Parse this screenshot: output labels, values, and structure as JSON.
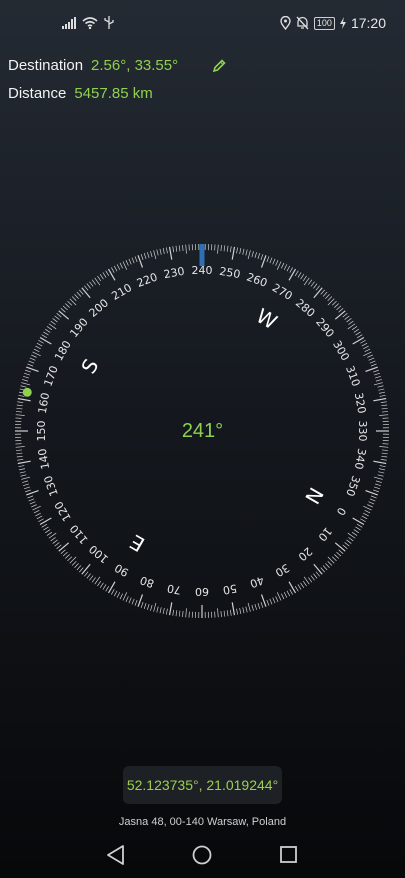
{
  "status_bar": {
    "time": "17:20",
    "battery": "100"
  },
  "destination": {
    "label": "Destination",
    "value": "2.56°, 33.55°"
  },
  "distance": {
    "label": "Distance",
    "value": "5457.85 km"
  },
  "compass": {
    "heading": "241°",
    "ring_labels": [
      "0",
      "10",
      "20",
      "30",
      "40",
      "50",
      "60",
      "70",
      "80",
      "90",
      "100",
      "110",
      "120",
      "130",
      "140",
      "150",
      "160",
      "170",
      "180",
      "190",
      "200",
      "210",
      "220",
      "230",
      "240",
      "250",
      "260",
      "270",
      "280",
      "290",
      "300",
      "310",
      "320",
      "330",
      "340",
      "350"
    ],
    "cardinals": {
      "N": "N",
      "E": "E",
      "S": "S",
      "W": "W"
    }
  },
  "location": {
    "coordinates": "52.123735°, 21.019244°",
    "address": "Jasna 48, 00-140 Warsaw, Poland"
  },
  "colors": {
    "accent": "#8fd14f",
    "indicator": "#2f6fb3"
  }
}
